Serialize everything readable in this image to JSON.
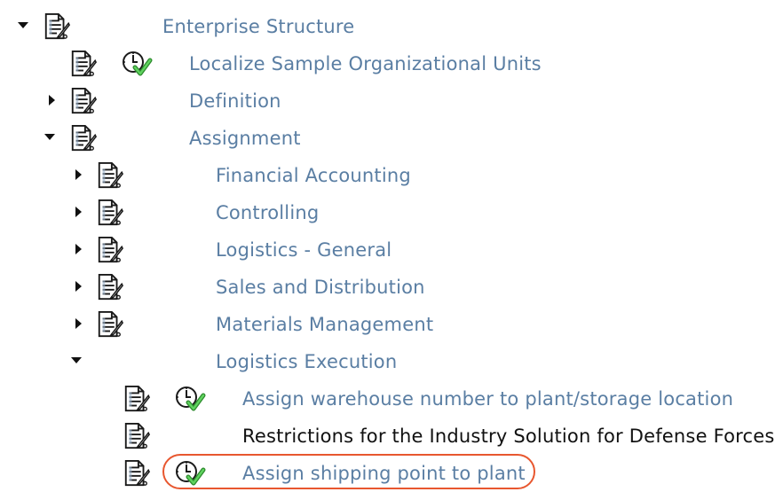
{
  "tree": {
    "root": {
      "label": "Enterprise Structure"
    },
    "localize": {
      "label": "Localize Sample Organizational Units"
    },
    "definition": {
      "label": "Definition"
    },
    "assignment": {
      "label": "Assignment"
    },
    "financial_accounting": {
      "label": "Financial Accounting"
    },
    "controlling": {
      "label": "Controlling"
    },
    "logistics_general": {
      "label": "Logistics - General"
    },
    "sales_distribution": {
      "label": "Sales and Distribution"
    },
    "materials_management": {
      "label": "Materials Management"
    },
    "logistics_execution": {
      "label": "Logistics Execution"
    },
    "assign_warehouse": {
      "label": "Assign warehouse number to plant/storage location"
    },
    "restrictions_defense": {
      "label": "Restrictions for the Industry Solution for Defense Forces"
    },
    "assign_shipping_point": {
      "label": "Assign shipping point to plant"
    }
  },
  "colors": {
    "link_text": "#5a7ea3",
    "plain_text": "#111111",
    "highlight": "#e8572f",
    "check_green": "#3aa83a"
  },
  "icons": {
    "documentation": "document-pen-icon",
    "execute": "clock-check-icon",
    "expanded": "triangle-down-icon",
    "collapsed": "triangle-right-icon"
  }
}
